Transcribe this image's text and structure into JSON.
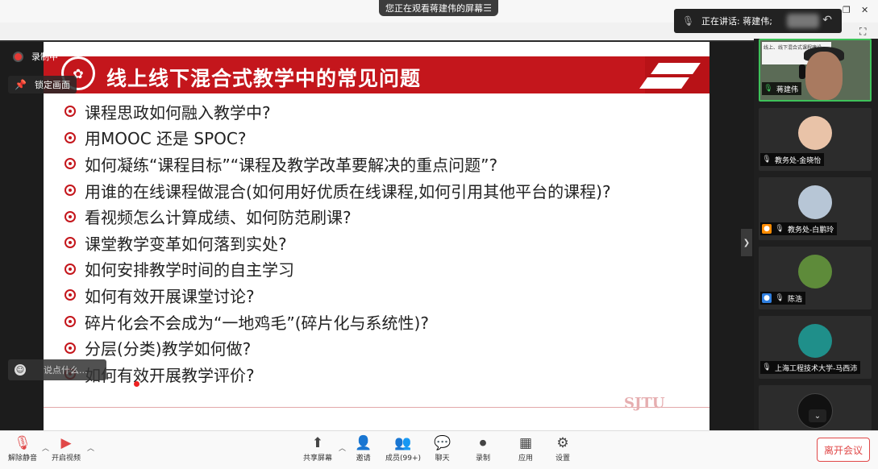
{
  "top": {
    "sharing_text": "您正在观看蒋建伟的屏幕",
    "speaking_label": "正在讲话: 蒋建伟;",
    "menu_icon": "menu-icon"
  },
  "overlays": {
    "recording": "录制中",
    "lock_view": "锁定画面",
    "chat_placeholder": "说点什么..."
  },
  "slide": {
    "title": "线上线下混合式教学中的常见问题",
    "accent_color": "#c4161c",
    "items": [
      "课程思政如何融入教学中?",
      "用MOOC 还是 SPOC?",
      "如何凝练“课程目标”“课程及教学改革要解决的重点问题”?",
      "用谁的在线课程做混合(如何用好优质在线课程,如何引用其他平台的课程)?",
      "看视频怎么计算成绩、如何防范刷课?",
      "课堂教学变革如何落到实处?",
      "如何安排教学时间的自主学习",
      "如何有效开展课堂讨论?",
      "碎片化会不会成为“一地鸡毛”(碎片化与系统性)?",
      "分层(分类)教学如何做?",
      "如何有效开展教学评价?"
    ],
    "footer_mark": "SJTU"
  },
  "participants": [
    {
      "name": "蒋建伟",
      "thumb_title": "线上、线下混合式课程建设"
    },
    {
      "name": "教务处-金晓怡"
    },
    {
      "name": "教务处-白鹏玲"
    },
    {
      "name": "陈浩"
    },
    {
      "name": "上海工程技术大学-马西沛"
    },
    {
      "name": ""
    }
  ],
  "toolbar": {
    "unmute": "解除静音",
    "start_video": "开启视频",
    "share_screen": "共享屏幕",
    "invite": "邀请",
    "members": "成员(99+)",
    "chat": "聊天",
    "record": "录制",
    "apps": "应用",
    "settings": "设置",
    "leave": "离开会议"
  }
}
